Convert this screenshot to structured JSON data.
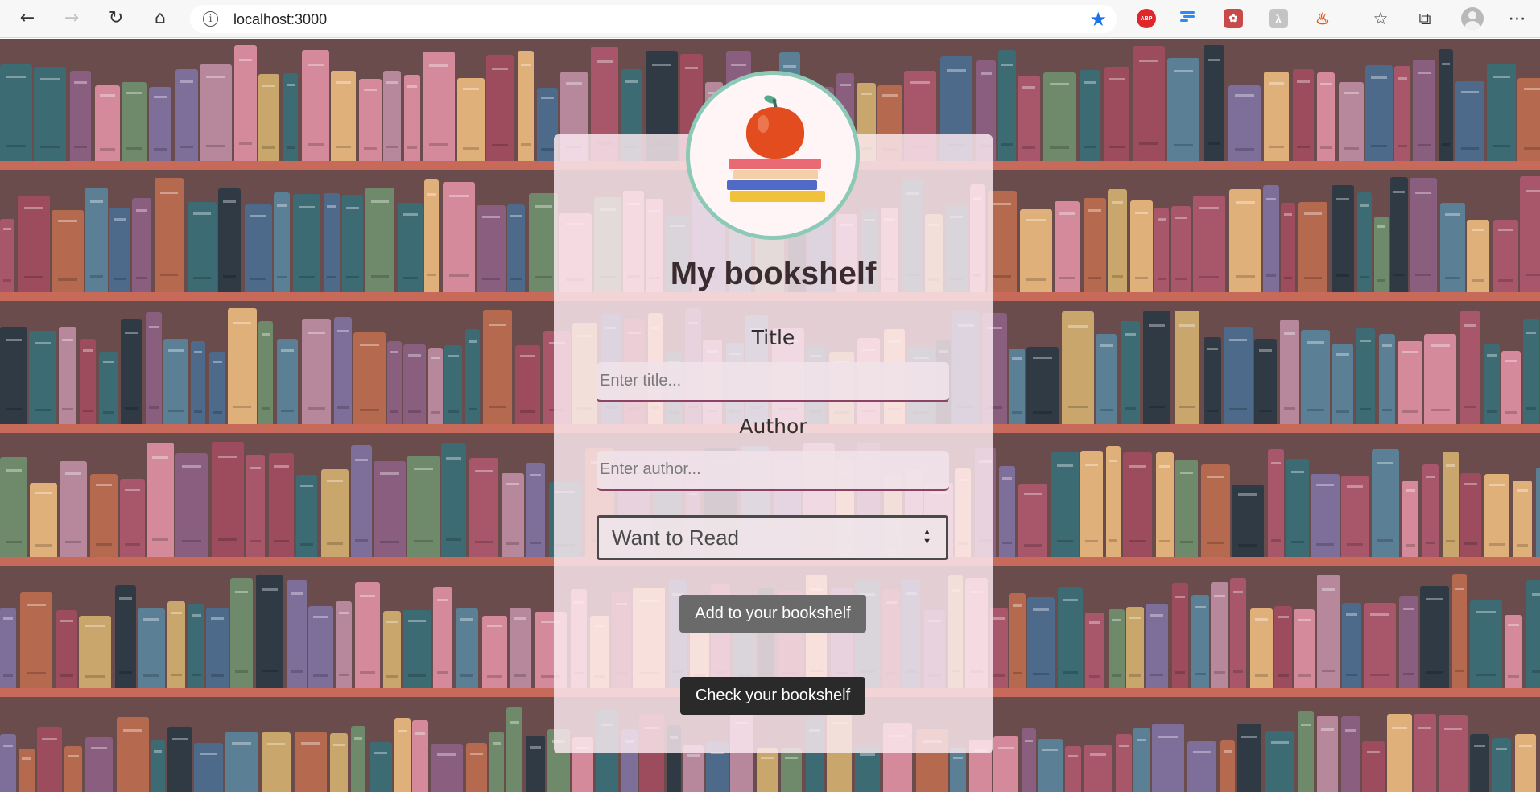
{
  "browser": {
    "url": "localhost:3000",
    "back_icon": "back-arrow-icon",
    "forward_icon": "forward-arrow-icon",
    "reload_icon": "reload-icon",
    "home_icon": "home-icon",
    "extensions": [
      {
        "name": "adblock-plus-icon",
        "label": "ABP"
      },
      {
        "name": "list-extension-icon",
        "label": ""
      },
      {
        "name": "red-extension-icon",
        "label": ""
      },
      {
        "name": "gray-extension-icon",
        "label": ""
      },
      {
        "name": "fire-extension-icon",
        "label": ""
      }
    ],
    "accent": "#1a73e8"
  },
  "app": {
    "title": "My bookshelf",
    "title_label": "Title",
    "title_placeholder": "Enter title...",
    "author_label": "Author",
    "author_placeholder": "Enter author...",
    "status_selected": "Want to Read",
    "add_button": "Add to your bookshelf",
    "check_button": "Check your bookshelf"
  },
  "colors": {
    "add_button_bg": "#6a6a6a",
    "check_button_bg": "#2a2a2a",
    "input_underline": "#8b4466",
    "logo_ring": "#8cc9b6"
  }
}
